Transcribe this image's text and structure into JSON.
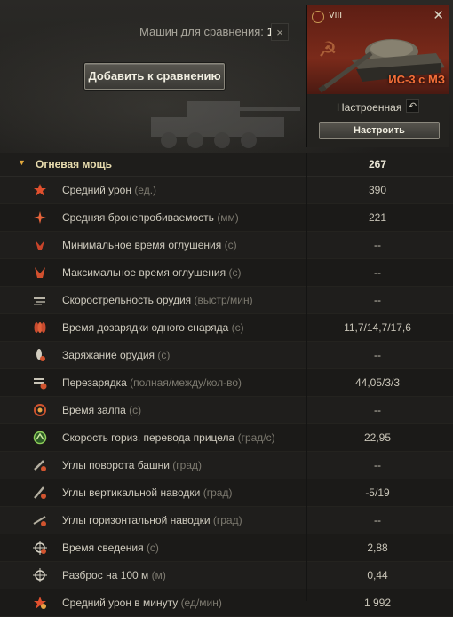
{
  "header": {
    "compare_label": "Машин для сравнения:",
    "compare_count": "1",
    "clear_symbol": "×",
    "add_button": "Добавить к сравнению"
  },
  "vehicle": {
    "tier": "VIII",
    "name": "ИС-3 с МЗ",
    "config_state": "Настроенная",
    "reset_symbol": "↶",
    "configure_button": "Настроить",
    "close_symbol": "✕"
  },
  "section": {
    "title": "Огневая мощь",
    "value": "267"
  },
  "rows": [
    {
      "label": "Средний урон",
      "unit": "(ед.)",
      "value": "390",
      "icon": "damage-icon"
    },
    {
      "label": "Средняя бронепробиваемость",
      "unit": "(мм)",
      "value": "221",
      "icon": "penetration-icon"
    },
    {
      "label": "Минимальное время оглушения",
      "unit": "(с)",
      "value": "--",
      "icon": "stun-min-icon"
    },
    {
      "label": "Максимальное время оглушения",
      "unit": "(с)",
      "value": "--",
      "icon": "stun-max-icon"
    },
    {
      "label": "Скорострельность орудия",
      "unit": "(выстр/мин)",
      "value": "--",
      "icon": "rate-of-fire-icon"
    },
    {
      "label": "Время дозарядки одного снаряда",
      "unit": "(с)",
      "value": "11,7/14,7/17,6",
      "icon": "shell-reload-icon"
    },
    {
      "label": "Заряжание орудия",
      "unit": "(с)",
      "value": "--",
      "icon": "loading-icon"
    },
    {
      "label": "Перезарядка",
      "unit": "(полная/между/кол-во)",
      "value": "44,05/3/3",
      "icon": "reload-icon"
    },
    {
      "label": "Время залпа",
      "unit": "(с)",
      "value": "--",
      "icon": "salvo-icon"
    },
    {
      "label": "Скорость гориз. перевода прицела",
      "unit": "(град/с)",
      "value": "22,95",
      "icon": "traverse-speed-icon"
    },
    {
      "label": "Углы поворота башни",
      "unit": "(град)",
      "value": "--",
      "icon": "turret-angle-icon"
    },
    {
      "label": "Углы вертикальной наводки",
      "unit": "(град)",
      "value": "-5/19",
      "icon": "elevation-icon"
    },
    {
      "label": "Углы горизонтальной наводки",
      "unit": "(град)",
      "value": "--",
      "icon": "horizontal-aim-icon"
    },
    {
      "label": "Время сведения",
      "unit": "(с)",
      "value": "2,88",
      "icon": "aim-time-icon"
    },
    {
      "label": "Разброс на 100 м",
      "unit": "(м)",
      "value": "0,44",
      "icon": "dispersion-icon"
    },
    {
      "label": "Средний урон в минуту",
      "unit": "(ед/мин)",
      "value": "1 992",
      "icon": "dpm-icon"
    }
  ]
}
